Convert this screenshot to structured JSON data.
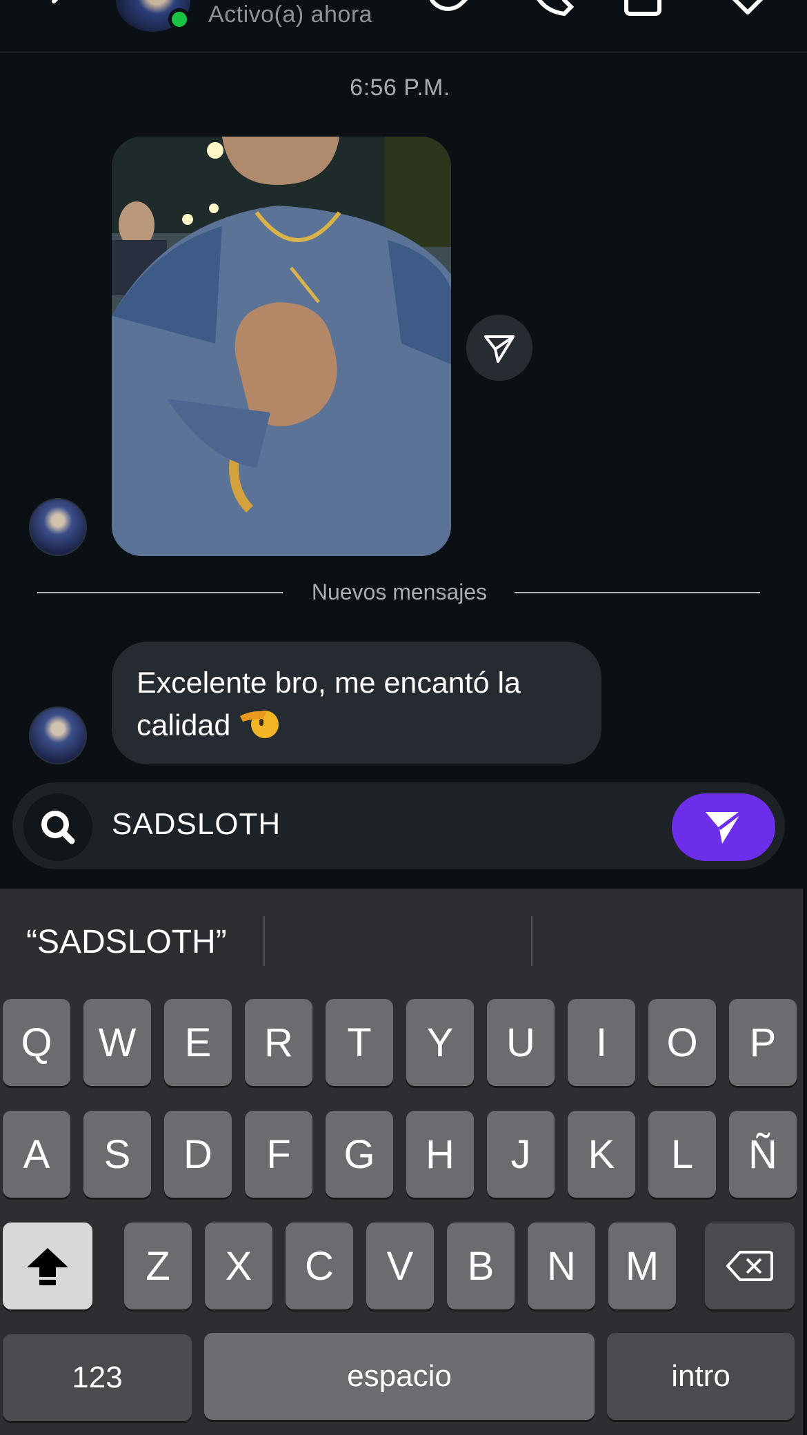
{
  "header": {
    "status": "Activo(a) ahora",
    "icons": [
      "back-icon",
      "sticker-icon",
      "phone-icon",
      "video-icon",
      "tag-icon"
    ]
  },
  "chat": {
    "timestamp": "6:56 P.M.",
    "divider": "Nuevos mensajes",
    "message_text": "Excelente bro, me encantó la calidad",
    "message_emoji": "🫡"
  },
  "composer": {
    "value": "SADSLOTH",
    "send_color": "#6c2ee8"
  },
  "keyboard": {
    "suggestion": "“SADSLOTH”",
    "row1": [
      "Q",
      "W",
      "E",
      "R",
      "T",
      "Y",
      "U",
      "I",
      "O",
      "P"
    ],
    "row2": [
      "A",
      "S",
      "D",
      "F",
      "G",
      "H",
      "J",
      "K",
      "L",
      "Ñ"
    ],
    "row3": [
      "Z",
      "X",
      "C",
      "V",
      "B",
      "N",
      "M"
    ],
    "numbers_label": "123",
    "space_label": "espacio",
    "return_label": "intro"
  }
}
